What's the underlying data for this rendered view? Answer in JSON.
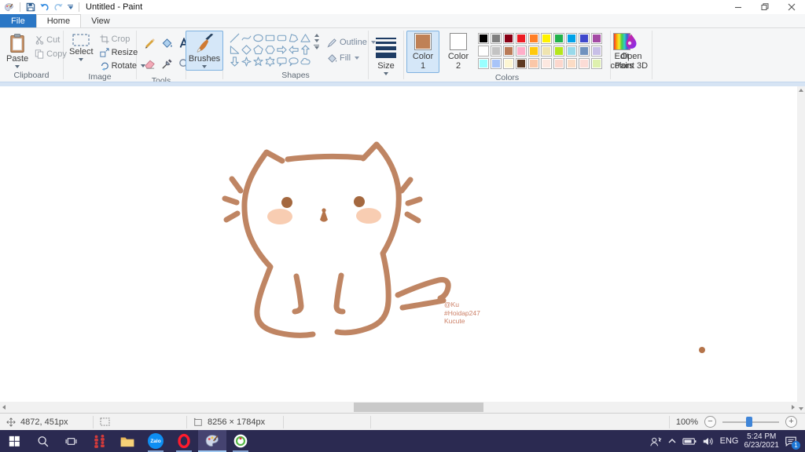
{
  "window": {
    "title": "Untitled - Paint"
  },
  "tabs": {
    "file": "File",
    "home": "Home",
    "view": "View"
  },
  "ribbon": {
    "clipboard": {
      "label": "Clipboard",
      "paste": "Paste",
      "cut": "Cut",
      "copy": "Copy"
    },
    "image": {
      "label": "Image",
      "select": "Select",
      "crop": "Crop",
      "resize": "Resize",
      "rotate": "Rotate"
    },
    "tools": {
      "label": "Tools"
    },
    "brushes": {
      "label": "Brushes"
    },
    "shapes": {
      "label": "Shapes",
      "outline": "Outline",
      "fill": "Fill",
      "items": [
        "line",
        "curve",
        "ellipse",
        "rectangle",
        "rounded-rectangle",
        "polygon",
        "triangle",
        "right-triangle",
        "diamond",
        "pentagon",
        "hexagon",
        "arrow-right",
        "arrow-left",
        "arrow-up",
        "arrow-down",
        "star-4",
        "star-5",
        "star-6",
        "callout-rounded",
        "callout-oval",
        "callout-cloud"
      ]
    },
    "size": {
      "label": "Size"
    },
    "colors": {
      "label": "Colors",
      "color1_label": "Color 1",
      "color2_label": "Color 2",
      "edit_label": "Edit colors",
      "color1": "#bf8156",
      "color2": "#ffffff",
      "palette": [
        [
          "#000000",
          "#7f7f7f",
          "#880015",
          "#ed1c24",
          "#ff7f27",
          "#fff200",
          "#22b14c",
          "#00a2e8",
          "#3f48cc",
          "#a349a4"
        ],
        [
          "#ffffff",
          "#c3c3c3",
          "#b97a57",
          "#ffaec9",
          "#ffc90e",
          "#efe4b0",
          "#b5e61d",
          "#99d9ea",
          "#7092be",
          "#c8bfe7"
        ],
        [
          "#99ffff",
          "#a8c4f8",
          "#fdf6d3",
          "#5d3a22",
          "#fbc7a8",
          "#fde8e0",
          "#fcd7cd",
          "#fbdcc5",
          "#fcdcd6",
          "#def0ae"
        ]
      ]
    },
    "paint3d": {
      "label": "Open Paint 3D"
    }
  },
  "canvas": {
    "signature": [
      "@Ku",
      "#Hoidap247",
      "Kucute"
    ],
    "stroke_color": "#bf8563",
    "eye_color": "#a4683f",
    "cheek_color": "#f8cdb2",
    "signature_color": "#cc8168"
  },
  "status": {
    "cursor_position": "4872, 451px",
    "image_size": "8256 × 1784px",
    "zoom_level": "100%"
  },
  "taskbar": {
    "zalo_text": "Zalo",
    "language": "ENG",
    "time": "5:24 PM",
    "date": "6/23/2021",
    "notification_count": "1"
  }
}
